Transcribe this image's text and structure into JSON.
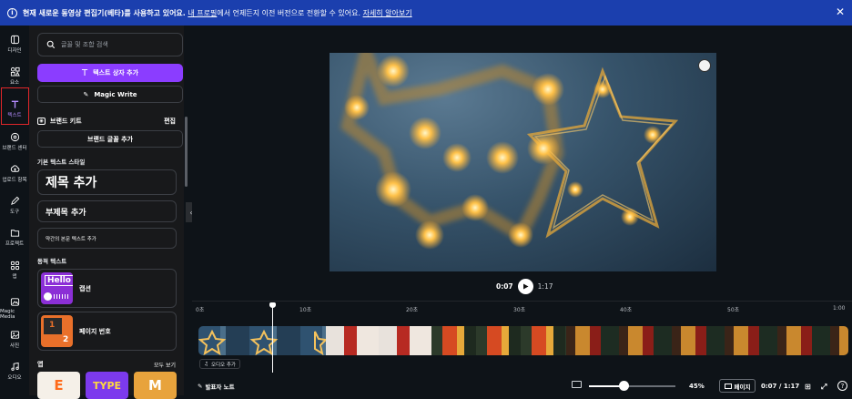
{
  "banner": {
    "bold_text": "현재 새로운 동영상 편집기(베타)를 사용하고 있어요.",
    "link_old": "내 프로필",
    "middle_text": "에서 언제든지 이전 버전으로 전환할 수 있어요.",
    "link_more": "자세히 알아보기"
  },
  "rail": {
    "items": [
      {
        "label": "디자인",
        "icon": "layout-icon"
      },
      {
        "label": "요소",
        "icon": "elements-icon"
      },
      {
        "label": "텍스트",
        "icon": "text-icon"
      },
      {
        "label": "브랜드 센터",
        "icon": "brand-icon"
      },
      {
        "label": "업로드 항목",
        "icon": "upload-icon"
      },
      {
        "label": "도구",
        "icon": "draw-icon"
      },
      {
        "label": "프로젝트",
        "icon": "folder-icon"
      },
      {
        "label": "앱",
        "icon": "apps-icon"
      },
      {
        "label": "Magic Media",
        "icon": "magic-media-icon"
      },
      {
        "label": "사진",
        "icon": "photo-icon"
      },
      {
        "label": "오디오",
        "icon": "audio-icon"
      }
    ]
  },
  "panel": {
    "search_placeholder": "글꼴 및 조합 검색",
    "add_textbox": "텍스트 상자 추가",
    "magic_write": "Magic Write",
    "brand_kit": "브랜드 키트",
    "edit": "편집",
    "add_brand_font": "브랜드 글꼴 추가",
    "default_styles_title": "기본 텍스트 스타일",
    "heading": "제목 추가",
    "subheading": "부제목 추가",
    "body": "약간의 본문 텍스트 추가",
    "dynamic_title": "동적 텍스트",
    "caption": "캡션",
    "caption_thumb": "Hello",
    "page_number": "페이지 번호",
    "page_thumb_1": "1",
    "page_thumb_2": "2",
    "apps_title": "앱",
    "see_all": "모두 보기",
    "app_tile_2": "TYPE",
    "app_tile_3": "M"
  },
  "player": {
    "current": "0:07",
    "total": "1:17"
  },
  "timeline": {
    "ticks": [
      "0초",
      "10초",
      "20초",
      "30초",
      "40초",
      "50초",
      "1:00"
    ],
    "add_audio": "오디오 추가"
  },
  "bottom": {
    "notes": "발표자 노트",
    "zoom": "45%",
    "zoom_level": 0.4,
    "pages": "페이지",
    "time": "0:07 / 1:17"
  },
  "colors": {
    "accent": "#8b3dff",
    "banner": "#1b3fae"
  }
}
